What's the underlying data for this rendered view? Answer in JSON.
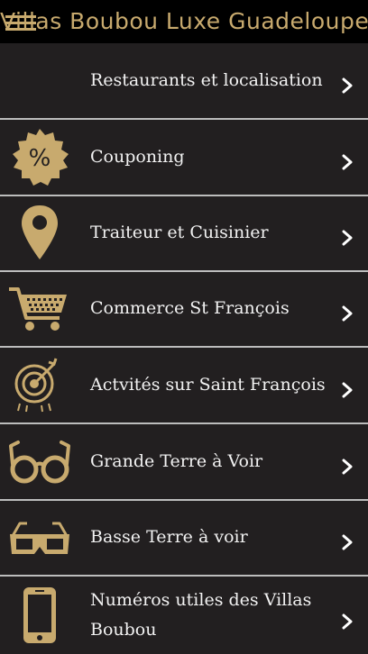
{
  "header": {
    "title": "Villas Boubou Luxe Guadeloupe",
    "menu_icon": "hamburger-icon"
  },
  "colors": {
    "gold": "#c8aa6e",
    "row_background": "#221f20",
    "divider": "#bdbdbd",
    "text": "#f2f2f2"
  },
  "menu": {
    "items": [
      {
        "label": "Restaurants et localisation",
        "icon": "none"
      },
      {
        "label": "Couponing",
        "icon": "percent-badge-icon"
      },
      {
        "label": "Traiteur et Cuisinier",
        "icon": "map-pin-icon"
      },
      {
        "label": "Commerce St François",
        "icon": "shopping-cart-icon"
      },
      {
        "label": "Actvités sur Saint François",
        "icon": "target-icon"
      },
      {
        "label": "Grande Terre à Voir",
        "icon": "glasses-icon"
      },
      {
        "label": "Basse Terre à voir",
        "icon": "3d-glasses-icon"
      },
      {
        "label": "Numéros utiles des Villas Boubou",
        "icon": "smartphone-icon"
      }
    ]
  }
}
